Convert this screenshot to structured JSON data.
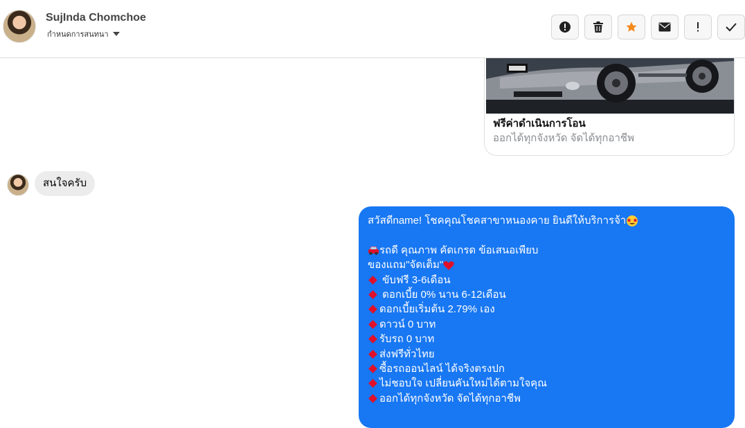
{
  "header": {
    "contact_name": "SujInda Chomchoe",
    "stage_label": "กำหนดการสนทนา"
  },
  "actions": [
    {
      "name": "report-icon"
    },
    {
      "name": "trash-icon"
    },
    {
      "name": "star-icon",
      "color": "#f5891b"
    },
    {
      "name": "envelope-icon"
    },
    {
      "name": "exclamation-icon"
    },
    {
      "name": "check-icon"
    }
  ],
  "card": {
    "title": "ฟรีค่าดำเนินการโอน",
    "subtitle": "ออกได้ทุกจังหวัด จัดได้ทุกอาชีพ"
  },
  "incoming": {
    "text": "สนใจครับ"
  },
  "outgoing": {
    "greeting": "สวัสดีname! โชคคุณโชคสาขาหนองคาย ยินดีให้บริการจ้า",
    "intro": "รถดี คุณภาพ คัดเกรด ข้อเสนอเพียบ",
    "freebies": "ของแถม\"จัดเต็ม\"",
    "bullets": [
      " ขับฟรี 3-6เดือน",
      " ดอกเบี้ย 0% นาน 6-12เดือน",
      "ดอกเบี้ยเริ่มต้น 2.79% เอง",
      "ดาวน์ 0 บาท",
      "รับรถ 0 บาท",
      "ส่งฟรีทั่วไทย",
      "ซื้อรถออนไลน์ ได้จริงตรงปก",
      "ไม่ชอบใจ เปลี่ยนคันใหม่ได้ตามใจคุณ",
      "ออกได้ทุกจังหวัด จัดได้ทุกอาชีพ"
    ]
  },
  "colors": {
    "outgoing_bubble": "#1877f2",
    "incoming_bubble": "#ececec",
    "bullet_diamond": "#e0102a"
  }
}
